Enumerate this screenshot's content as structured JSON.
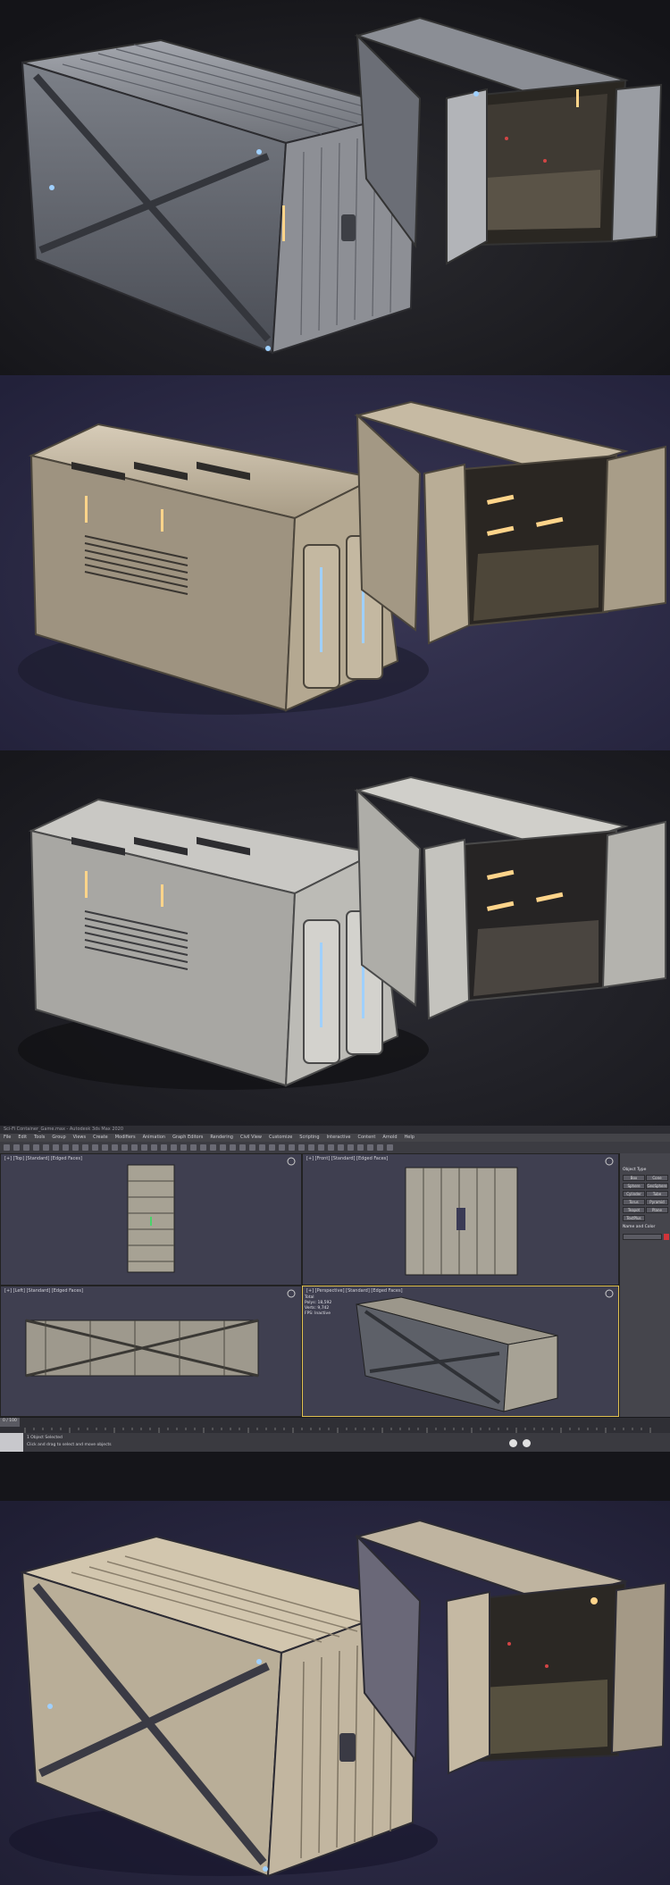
{
  "image": {
    "description_panels": 5
  },
  "max_ui": {
    "title": "Sci-Fi Container_Game.max - Autodesk 3ds Max 2020",
    "menus": [
      "File",
      "Edit",
      "Tools",
      "Group",
      "Views",
      "Create",
      "Modifiers",
      "Animation",
      "Graph Editors",
      "Rendering",
      "Civil View",
      "Customize",
      "Scripting",
      "Interactive",
      "Content",
      "Arnold",
      "Help"
    ],
    "viewports": {
      "top": "[+] [Top] [Standard] [Edged Faces]",
      "front": "[+] [Front] [Standard] [Edged Faces]",
      "left": "[+] [Left] [Standard] [Edged Faces]",
      "perspective": "[+] [Perspective] [Standard] [Edged Faces]"
    },
    "stats": "Total\nPolys: 18,592\nVerts: 9,742\nFPS: Inactive",
    "command_panel": {
      "section1": "Object Type",
      "section2": "Name and Color",
      "buttons": [
        "Box",
        "Cone",
        "Sphere",
        "GeoSphere",
        "Cylinder",
        "Tube",
        "Torus",
        "Pyramid",
        "Teapot",
        "Plane",
        "TextPlus"
      ]
    },
    "status_line1": "1 Object Selected",
    "status_line2": "Click and drag to select and move objects",
    "frame": "0 / 100"
  },
  "colors": {
    "bg_dark": "#1c1c22",
    "bg_purple": "#2b2a40",
    "metal_dark": "#5a5d66",
    "metal_light": "#b8b4ac",
    "tan": "#c9bca6",
    "light_glow": "#ffd48a",
    "blue_glow": "#9fd0ff"
  }
}
